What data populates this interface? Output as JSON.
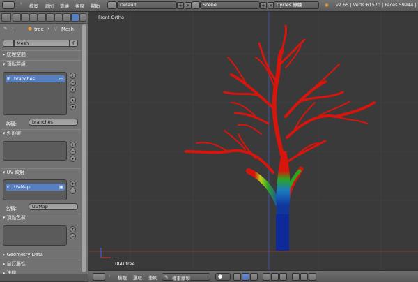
{
  "topbar": {
    "menus": [
      "檔案",
      "添加",
      "算繪",
      "視窗",
      "幫助"
    ],
    "screen_layout": "Default",
    "scene": "Scene",
    "render_engine": "Cycles 算繪",
    "stats": "v2.65 | Verts:61570 | Faces:59944 | T"
  },
  "properties": {
    "breadcrumb": {
      "object": "tree",
      "mesh": "Mesh"
    },
    "mesh_name": "Mesh",
    "fake_user": "F",
    "panels": {
      "texture_space": "紋理空間",
      "vertex_groups": "頂點群組",
      "shape_keys": "外形鍵",
      "uv_maps": "UV 映射",
      "vertex_colors": "頂點色彩",
      "geometry_data": "Geometry Data",
      "custom_props": "自訂屬性",
      "normals": "法線"
    },
    "vertex_group_item": "branches",
    "name_label": "名稱:",
    "vertex_group_name": "branches",
    "uv_item": "UVMap",
    "uv_name": "UVMap"
  },
  "viewport": {
    "view_name": "Front Ortho",
    "object_label": "(84) tree"
  },
  "bottombar": {
    "menus": [
      "檢視",
      "選取",
      "筆刷"
    ],
    "mode": "權重繪製"
  },
  "colors": {
    "selected": "#5680c2",
    "branch_red": "#d8150c",
    "trunk_blue": "#0d2a98",
    "mid_green": "#2fa420"
  }
}
